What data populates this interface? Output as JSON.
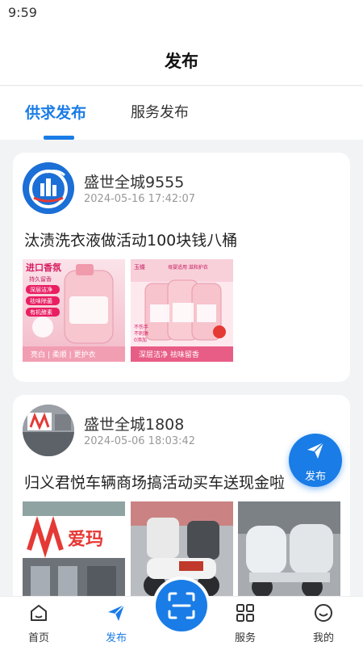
{
  "status_bar": {
    "time": "9:59"
  },
  "header": {
    "title": "发布"
  },
  "tabs": [
    {
      "label": "供求发布",
      "active": true
    },
    {
      "label": "服务发布",
      "active": false
    }
  ],
  "posts": [
    {
      "user": "盛世全城9555",
      "time": "2024-05-16 17:42:07",
      "title": "汰渍洗衣液做活动100块钱八桶",
      "images": [
        {
          "badge": "进口香氛",
          "sub": "持久留香",
          "tags": [
            "深层洁净",
            "祛味除菌",
            "有机酵素"
          ],
          "caption": "亮白 | 柔顺 | 更护衣"
        },
        {
          "badge": "玉蝶",
          "sub": "母婴适用 滋和护衣",
          "tags": [
            "不伤手",
            "不刺激",
            "0添加"
          ],
          "caption": "深层洁净 祛味留香"
        }
      ]
    },
    {
      "user": "盛世全城1808",
      "time": "2024-05-06 18:03:42",
      "title": "归义君悦车辆商场搞活动买车送现金啦",
      "images": [
        {
          "sign": "爱玛"
        },
        {},
        {}
      ]
    }
  ],
  "fab": {
    "label": "发布",
    "icon": "paper-plane-icon"
  },
  "bottom_nav": [
    {
      "label": "首页",
      "icon": "home-icon",
      "active": false
    },
    {
      "label": "发布",
      "icon": "paper-plane-icon",
      "active": true
    },
    {
      "label": "服务",
      "icon": "grid-icon",
      "active": false
    },
    {
      "label": "我的",
      "icon": "smiley-icon",
      "active": false
    }
  ],
  "scan_button": {
    "icon": "scan-icon"
  },
  "colors": {
    "accent": "#1a7ce6",
    "background": "#f2f3f5"
  }
}
